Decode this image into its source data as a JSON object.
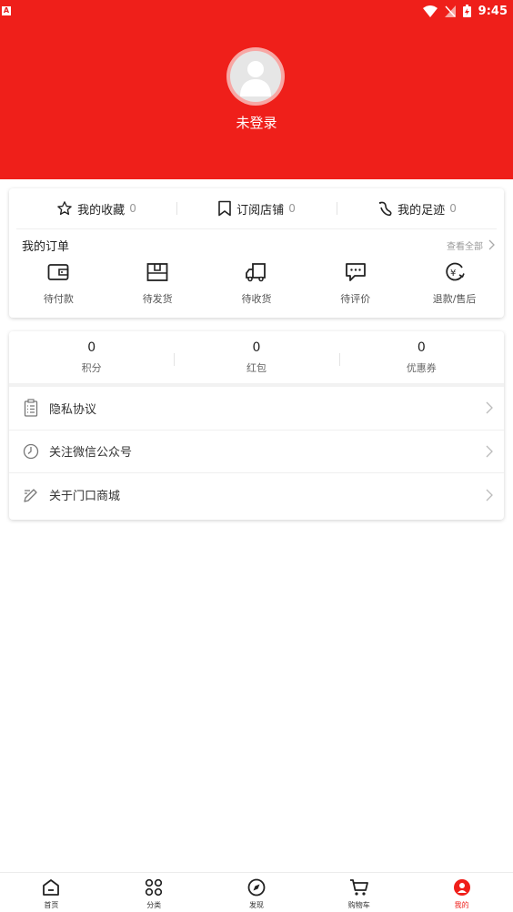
{
  "status_bar": {
    "time": "9:45",
    "left_glyph": "A"
  },
  "profile": {
    "login_status": "未登录"
  },
  "quick_links": [
    {
      "label": "我的收藏",
      "count": "0",
      "icon": "star-icon"
    },
    {
      "label": "订阅店铺",
      "count": "0",
      "icon": "bookmark-icon"
    },
    {
      "label": "我的足迹",
      "count": "0",
      "icon": "footprint-icon"
    }
  ],
  "orders": {
    "title": "我的订单",
    "view_all": "查看全部",
    "items": [
      {
        "label": "待付款",
        "icon": "wallet-icon"
      },
      {
        "label": "待发货",
        "icon": "package-icon"
      },
      {
        "label": "待收货",
        "icon": "truck-icon"
      },
      {
        "label": "待评价",
        "icon": "comment-icon"
      },
      {
        "label": "退款/售后",
        "icon": "refund-icon"
      }
    ]
  },
  "stats": [
    {
      "value": "0",
      "label": "积分"
    },
    {
      "value": "0",
      "label": "红包"
    },
    {
      "value": "0",
      "label": "优惠券"
    }
  ],
  "menu": [
    {
      "label": "隐私协议",
      "icon": "clipboard-icon"
    },
    {
      "label": "关注微信公众号",
      "icon": "clock-icon"
    },
    {
      "label": "关于门口商城",
      "icon": "edit-icon"
    }
  ],
  "tabbar": [
    {
      "label": "首页",
      "icon": "home-icon"
    },
    {
      "label": "分类",
      "icon": "grid-icon"
    },
    {
      "label": "发现",
      "icon": "compass-icon"
    },
    {
      "label": "购物车",
      "icon": "cart-icon"
    },
    {
      "label": "我的",
      "icon": "profile-icon",
      "active": true
    }
  ],
  "colors": {
    "brand": "#ef1f1a",
    "muted": "#999999"
  }
}
